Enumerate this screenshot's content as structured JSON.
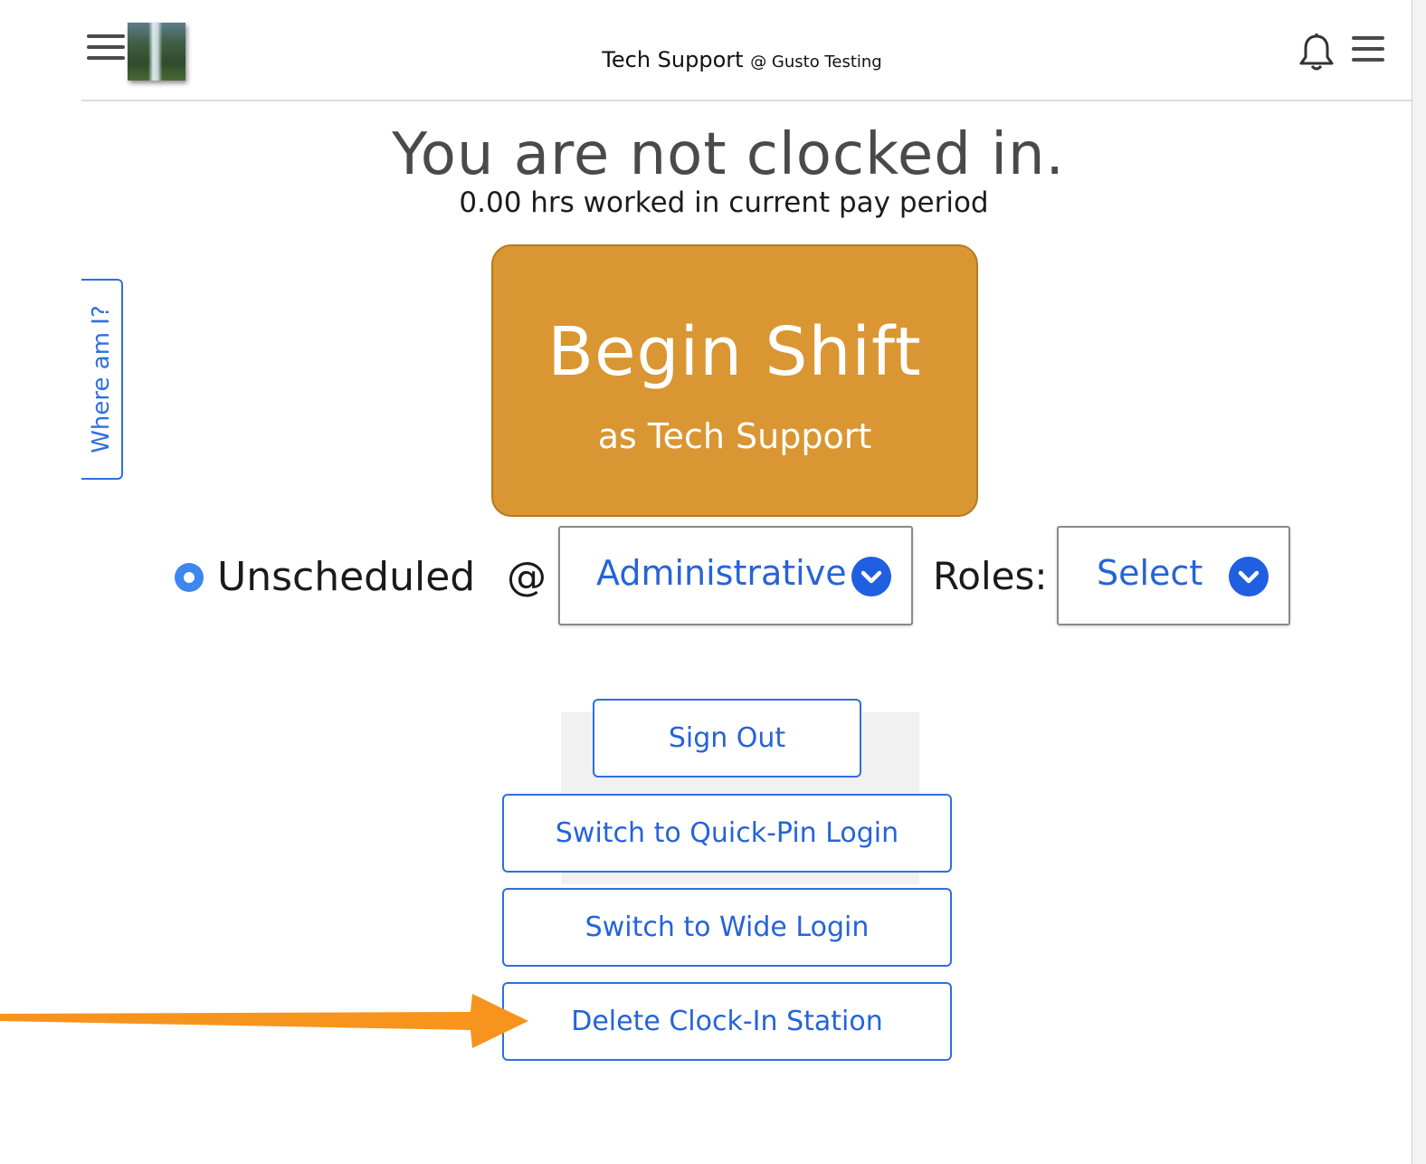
{
  "header": {
    "role": "Tech Support",
    "org": "@ Gusto Testing",
    "icons": {
      "left_menu": "hamburger-menu-icon",
      "avatar": "profile-avatar",
      "notifications": "bell-icon",
      "right_menu": "hamburger-menu-icon"
    }
  },
  "status": {
    "title": "You are not clocked in.",
    "hours_line": "0.00 hrs worked in current pay period"
  },
  "side_tab": {
    "label": "Where am I?"
  },
  "begin_shift": {
    "label": "Begin Shift",
    "sublabel": "as Tech Support",
    "color": "#d99632"
  },
  "shift_options": {
    "unscheduled_label": "Unscheduled",
    "at_label": "@",
    "department": "Administrative",
    "roles_label": "Roles:",
    "roles_value": "Select"
  },
  "actions": {
    "sign_out": "Sign Out",
    "quick_pin": "Switch to Quick-Pin Login",
    "wide_login": "Switch to Wide Login",
    "delete_station": "Delete Clock-In Station"
  },
  "colors": {
    "accent_blue": "#2f6fe0",
    "annotation_arrow": "#f7941d"
  }
}
